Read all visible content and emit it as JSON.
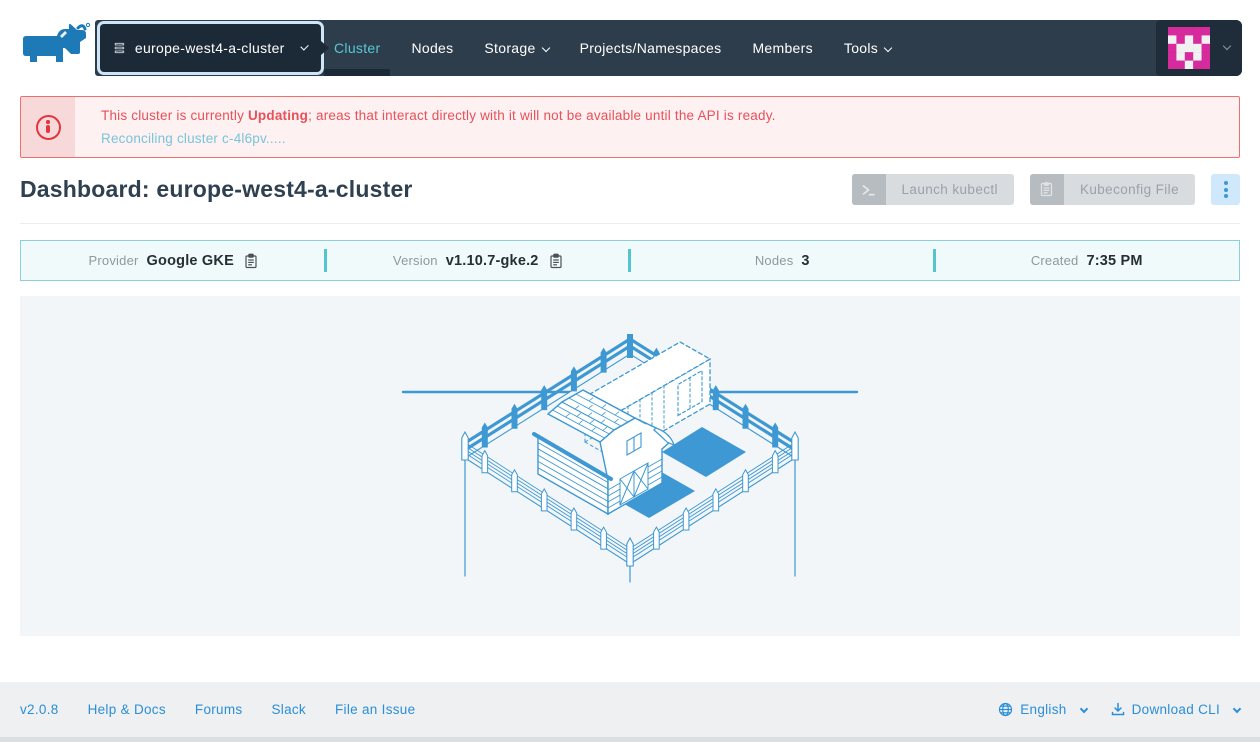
{
  "topbar": {
    "cluster_selector": "europe-west4-a-cluster",
    "nav_items": [
      "Cluster",
      "Nodes",
      "Storage",
      "Projects/Namespaces",
      "Members",
      "Tools"
    ]
  },
  "avatar": {
    "pattern": [
      "11111",
      "01010",
      "10001",
      "10101",
      "11011"
    ],
    "color": "#d62a9d",
    "bg": "#f1f1f1"
  },
  "alert": {
    "line1_pre": "This cluster is currently ",
    "status": "Updating",
    "line1_post": "; areas that interact directly with it will not be available until the API is ready.",
    "line2": "Reconciling cluster c-4l6pv....."
  },
  "header": {
    "title": "Dashboard: europe-west4-a-cluster",
    "buttons": {
      "launch_kubectl": "Launch kubectl",
      "kubeconfig": "Kubeconfig File"
    }
  },
  "infobar": {
    "items": [
      {
        "label": "Provider",
        "value": "Google GKE"
      },
      {
        "label": "Version",
        "value": "v1.10.7-gke.2"
      },
      {
        "label": "Nodes",
        "value": "3"
      },
      {
        "label": "Created",
        "value": "7:35 PM"
      }
    ]
  },
  "footer": {
    "version": "v2.0.8",
    "links": [
      "Help & Docs",
      "Forums",
      "Slack",
      "File an Issue"
    ],
    "language": "English",
    "download_cli": "Download CLI"
  },
  "colors": {
    "navbar": "#2e3d4c",
    "navbar_dark": "#1c2a38",
    "accent_teal": "#57c7d6",
    "alert_red": "#e4343f",
    "reconcile_blue": "#79c4d9",
    "illustration_blue": "#3d98d3",
    "avatar_pink": "#d62a9d",
    "link_blue": "#2b8ed6"
  }
}
